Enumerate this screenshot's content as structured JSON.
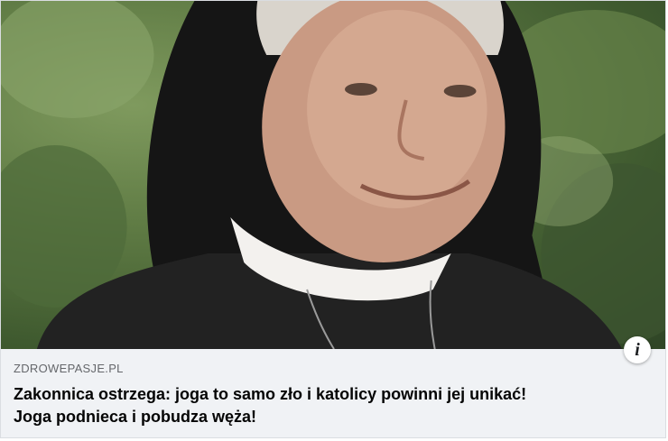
{
  "post": {
    "domain": "ZDROWEPASJE.PL",
    "headline_line1": "Zakonnica ostrzega: joga to samo zło i katolicy powinni jej unikać!",
    "headline_line2": "Joga podnieca i pobudza węża!",
    "info_icon": "info-icon"
  },
  "colors": {
    "meta_background": "#f0f2f5",
    "domain_text": "#65676b",
    "headline_text": "#050505"
  }
}
